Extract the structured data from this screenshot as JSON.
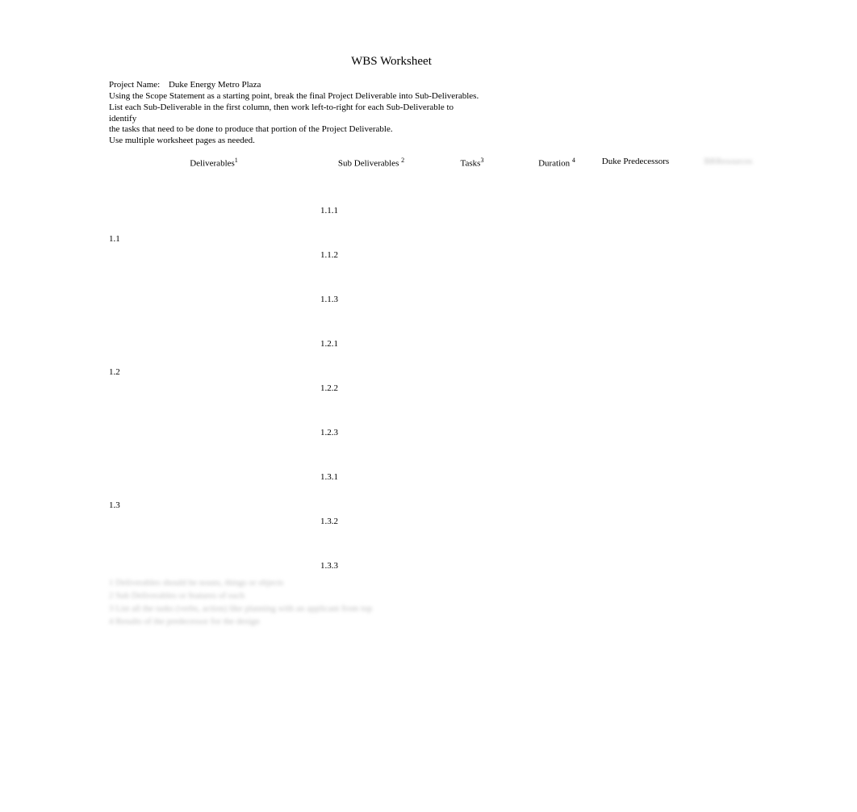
{
  "title": "WBS Worksheet",
  "project": {
    "label": "Project Name:",
    "value": "Duke Energy Metro Plaza"
  },
  "instructions": [
    "Using the Scope Statement as a starting point, break the final Project Deliverable into Sub-Deliverables.",
    "List each Sub-Deliverable in the first column, then work left-to-right for each Sub-Deliverable to identify",
    "the tasks that need to be done to produce that portion of the Project Deliverable.",
    "Use multiple worksheet pages as needed."
  ],
  "columns": {
    "deliverables": "Deliverables",
    "deliverables_sup": "1",
    "sub_deliverables": "Sub Deliverables",
    "sub_deliverables_sup": "2",
    "tasks": "Tasks",
    "tasks_sup": "3",
    "duration": "Duration",
    "duration_sup": "4",
    "predecessors": "Duke Predecessors",
    "resources": "BRResources"
  },
  "rows": [
    {
      "deliv": "1.1",
      "subs": [
        "1.1.1",
        "1.1.2",
        "1.1.3"
      ]
    },
    {
      "deliv": "1.2",
      "subs": [
        "1.2.1",
        "1.2.2",
        "1.2.3"
      ]
    },
    {
      "deliv": "1.3",
      "subs": [
        "1.3.1",
        "1.3.2",
        "1.3.3"
      ]
    }
  ],
  "footnotes": [
    "1 Deliverables should be nouns, things or objects",
    "2 Sub Deliverables or features of each",
    "3 List all the tasks (verbs, action) like planning with an applicant from top",
    "4 Results of the predecessor for the design"
  ]
}
